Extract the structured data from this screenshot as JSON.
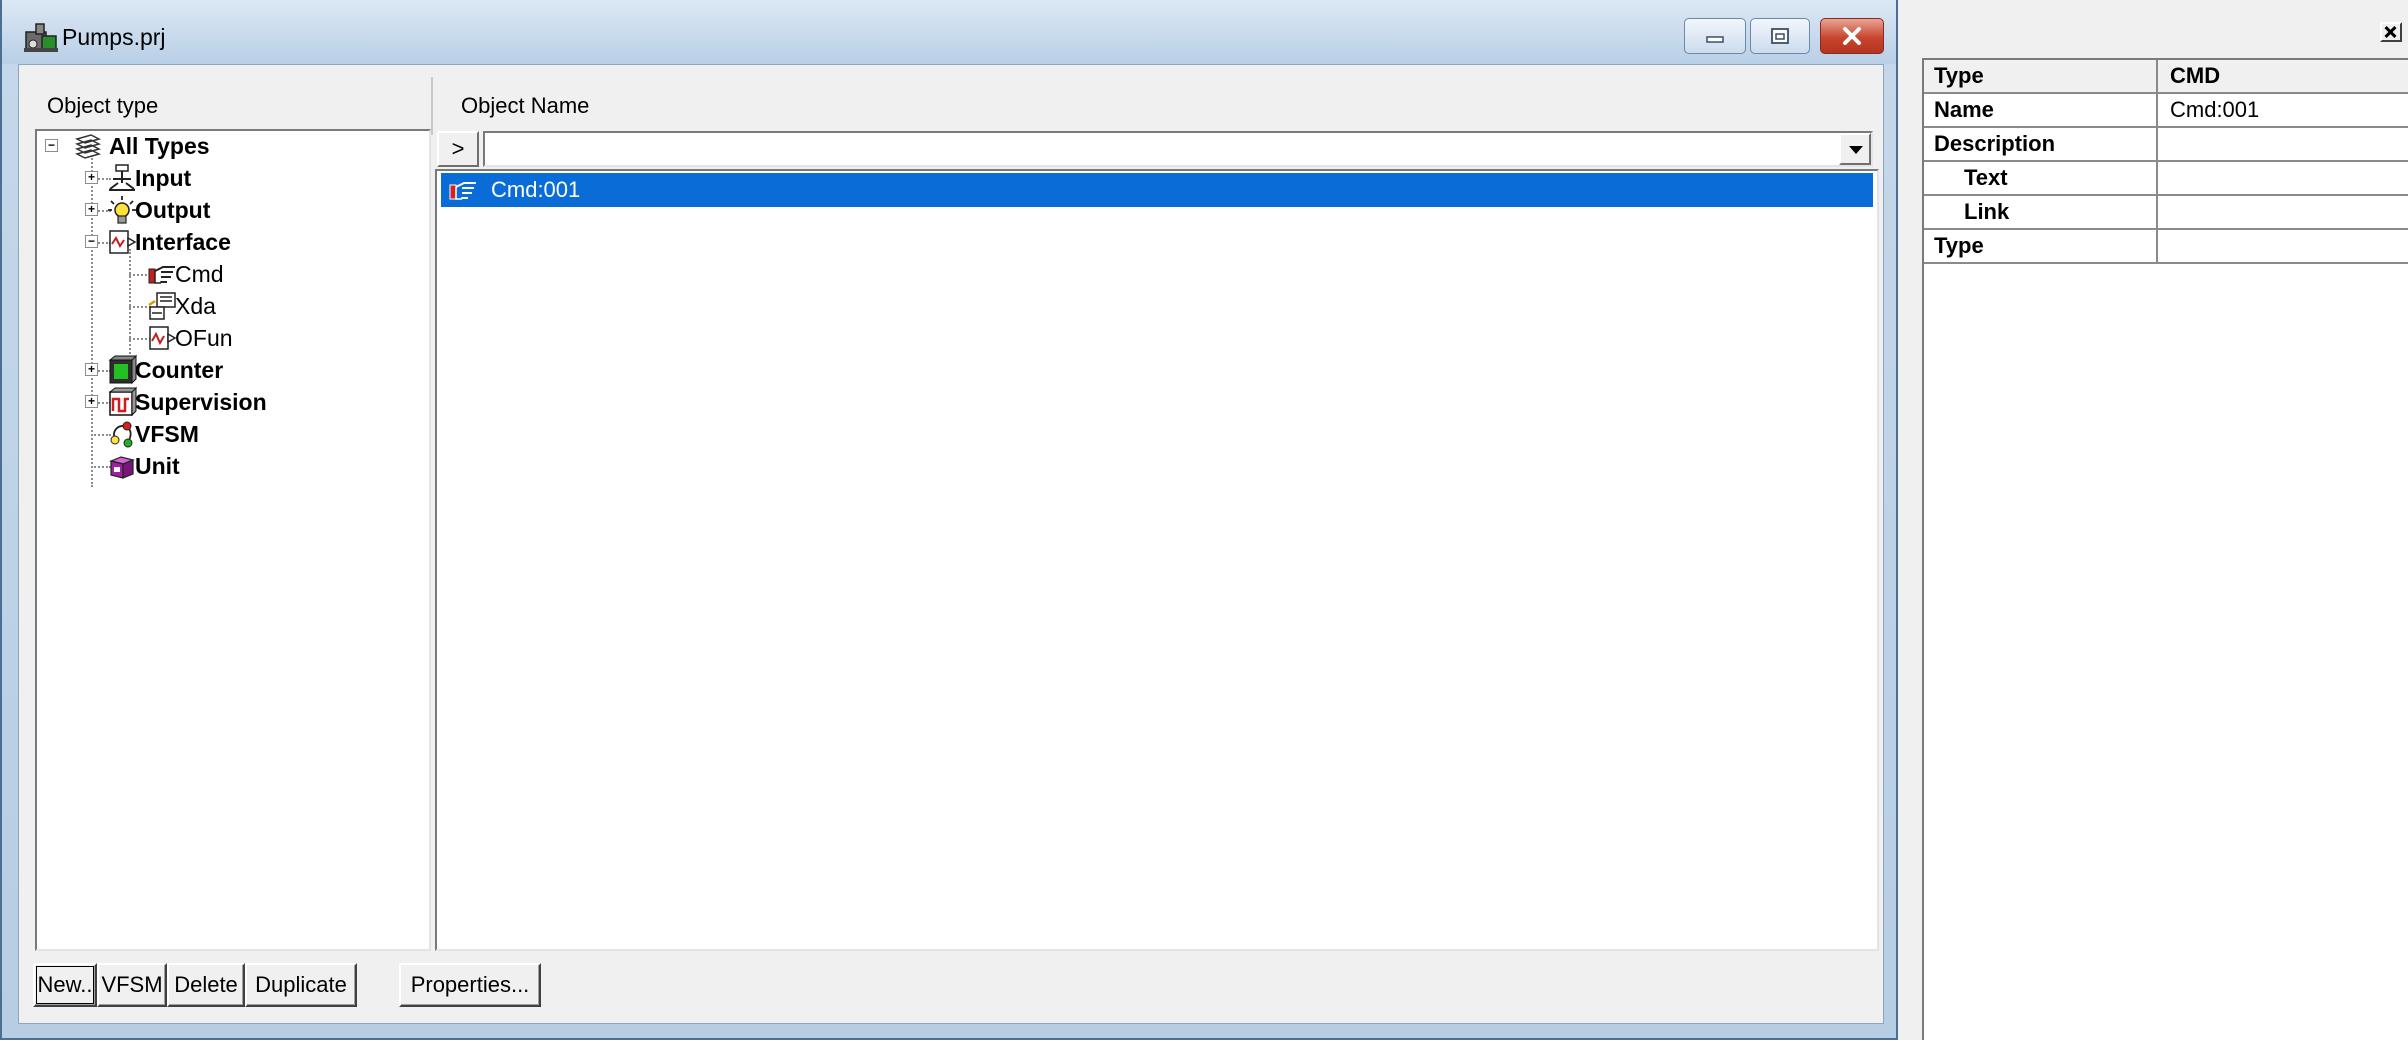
{
  "window": {
    "title": "Pumps.prj",
    "min_icon": "minimize-icon",
    "max_icon": "maximize-icon",
    "close_icon": "close-icon"
  },
  "headers": {
    "object_type": "Object type",
    "object_name": "Object Name"
  },
  "tree": {
    "root": "All Types",
    "items": [
      {
        "label": "Input",
        "icon": "input-icon",
        "bold": true
      },
      {
        "label": "Output",
        "icon": "lightbulb-icon",
        "bold": true
      },
      {
        "label": "Interface",
        "icon": "interface-icon",
        "bold": true
      },
      {
        "label": "Cmd",
        "icon": "hand-icon",
        "bold": false
      },
      {
        "label": "Xda",
        "icon": "xda-icon",
        "bold": false
      },
      {
        "label": "OFun",
        "icon": "ofun-icon",
        "bold": false
      },
      {
        "label": "Counter",
        "icon": "counter-icon",
        "bold": true
      },
      {
        "label": "Supervision",
        "icon": "supervision-icon",
        "bold": true
      },
      {
        "label": "VFSM",
        "icon": "vfsm-icon",
        "bold": true
      },
      {
        "label": "Unit",
        "icon": "unit-icon",
        "bold": true
      }
    ]
  },
  "filter": {
    "button_label": ">",
    "value": ""
  },
  "list": {
    "rows": [
      {
        "name": "Cmd:001",
        "icon": "hand-icon",
        "selected": true
      }
    ]
  },
  "buttons": {
    "new": "New..",
    "vfsm": "VFSM",
    "delete": "Delete",
    "duplicate": "Duplicate",
    "properties": "Properties..."
  },
  "properties": {
    "rows": [
      {
        "key": "Type",
        "value": "CMD"
      },
      {
        "key": "Name",
        "value": "Cmd:001"
      },
      {
        "key": "Description",
        "value": ""
      },
      {
        "key": "Text",
        "value": ""
      },
      {
        "key": "Link",
        "value": ""
      },
      {
        "key": "Type",
        "value": ""
      }
    ]
  },
  "colors": {
    "selection": "#0a6cd6",
    "close_button": "#c8452e"
  }
}
